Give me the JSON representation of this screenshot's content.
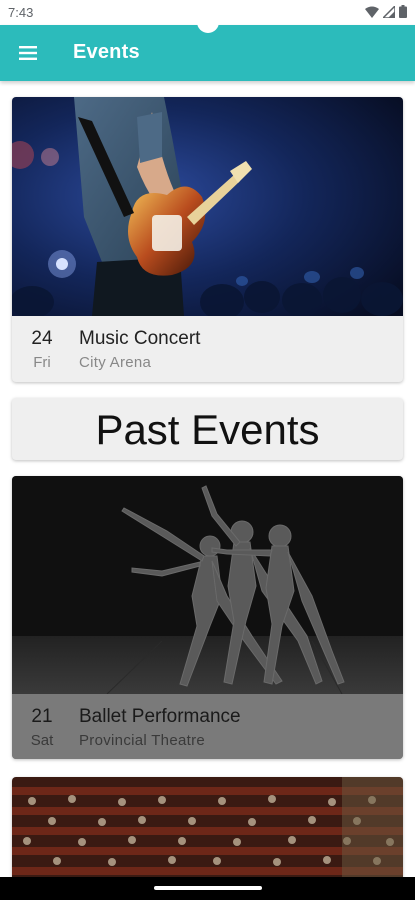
{
  "status_bar": {
    "time": "7:43",
    "icons": [
      "wifi-icon",
      "signal-icon",
      "battery-icon"
    ]
  },
  "app_bar": {
    "title": "Events",
    "menu_icon": "menu-icon",
    "color": "#2cbbbb"
  },
  "upcoming": [
    {
      "date": "24",
      "day": "Fri",
      "title": "Music Concert",
      "venue": "City Arena"
    }
  ],
  "past_heading": "Past Events",
  "past": [
    {
      "date": "21",
      "day": "Sat",
      "title": "Ballet Performance",
      "venue": "Provincial Theatre"
    }
  ],
  "colors": {
    "accent": "#2cbbbb",
    "card_background": "#efefef",
    "past_overlay": "#7a7a7a"
  }
}
